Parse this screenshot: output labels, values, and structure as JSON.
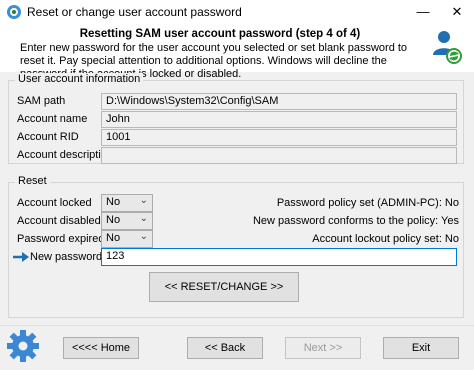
{
  "window": {
    "title": "Reset or change user account password",
    "minimize": "—",
    "close": "✕"
  },
  "header": {
    "heading": "Resetting SAM user account password (step 4 of 4)",
    "description": "Enter new password for the user account you selected or set blank password to reset it. Pay special attention to additional options. Windows will decline the password if the account is locked or disabled."
  },
  "user_info": {
    "legend": "User account information",
    "sam_path_label": "SAM path",
    "sam_path_value": "D:\\Windows\\System32\\Config\\SAM",
    "account_name_label": "Account name",
    "account_name_value": "John",
    "account_rid_label": "Account RID",
    "account_rid_value": "1001",
    "account_description_label": "Account description",
    "account_description_value": ""
  },
  "reset": {
    "legend": "Reset",
    "account_locked_label": "Account locked",
    "account_locked_value": "No",
    "account_disabled_label": "Account disabled",
    "account_disabled_value": "No",
    "password_expired_label": "Password expired",
    "password_expired_value": "No",
    "new_password_label": "New password",
    "new_password_value": "123",
    "policy_set": "Password policy set (ADMIN-PC): No",
    "conforms": "New password conforms to the policy: Yes",
    "lockout": "Account lockout policy set: No",
    "reset_button": "<< RESET/CHANGE >>"
  },
  "footer": {
    "home": "<<<< Home",
    "back": "<< Back",
    "next": "Next >>",
    "exit": "Exit"
  }
}
